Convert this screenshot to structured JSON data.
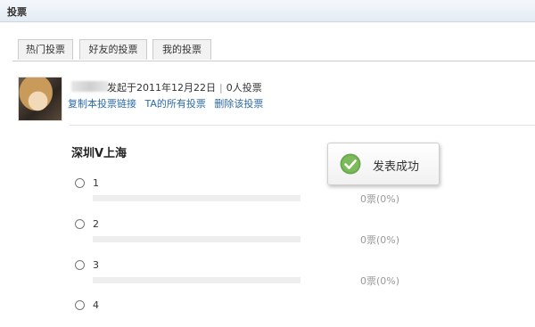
{
  "header": {
    "title": "投票"
  },
  "tabs": [
    {
      "label": "热门投票"
    },
    {
      "label": "好友的投票"
    },
    {
      "label": "我的投票"
    }
  ],
  "post": {
    "meta": "发起于2011年12月22日",
    "separator": "|",
    "votes_count": "0人投票",
    "links": {
      "copy_link": "复制本投票链接",
      "all_polls": "TA的所有投票",
      "delete": "删除该投票"
    }
  },
  "poll": {
    "title": "深圳V上海",
    "options": [
      {
        "label": "1",
        "count": "0票(0%)",
        "percent": 0
      },
      {
        "label": "2",
        "count": "0票(0%)",
        "percent": 0
      },
      {
        "label": "3",
        "count": "0票(0%)",
        "percent": 0
      },
      {
        "label": "4",
        "count": "",
        "percent": 0
      }
    ]
  },
  "toast": {
    "message": "发表成功",
    "icon": "checkmark-icon",
    "icon_color": "#6aa84f"
  },
  "colors": {
    "link": "#2b6aa6",
    "header_bg": "#e3ecf3"
  }
}
